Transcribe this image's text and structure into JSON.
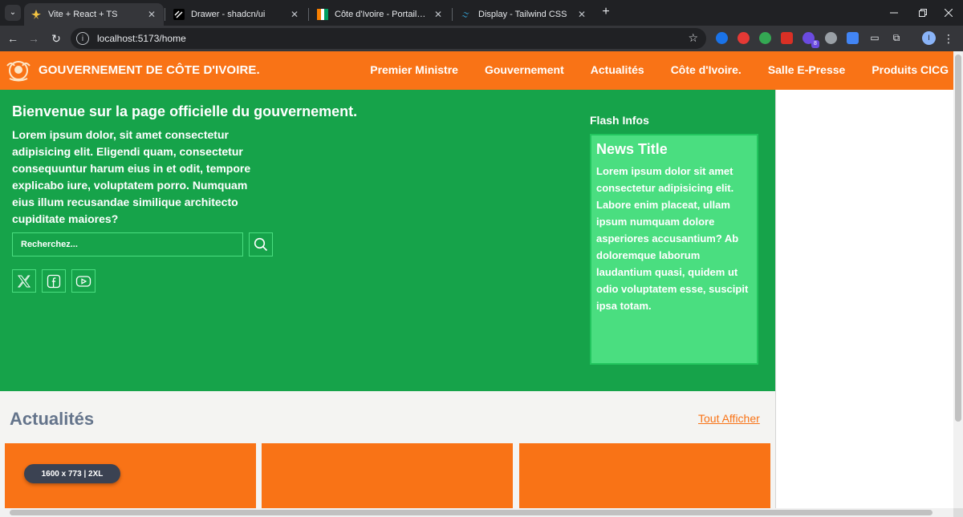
{
  "browser": {
    "tabs": [
      {
        "title": "Vite + React + TS",
        "favicon": "vite-icon",
        "active": true
      },
      {
        "title": "Drawer - shadcn/ui",
        "favicon": "shadcn-icon",
        "active": false
      },
      {
        "title": "Côte d'Ivoire - Portail officiel du",
        "favicon": "ivory-coast-flag-icon",
        "active": false
      },
      {
        "title": "Display - Tailwind CSS",
        "favicon": "tailwind-icon",
        "active": false
      }
    ],
    "tab_close": "✕",
    "new_tab": "+",
    "url": "localhost:5173/home",
    "extension_badge": "8",
    "profile_initial": "I"
  },
  "site": {
    "brand": "GOUVERNEMENT DE CÔTE D'IVOIRE.",
    "nav": [
      "Premier Ministre",
      "Gouvernement",
      "Actualités",
      "Côte d'Ivoire.",
      "Salle E-Presse",
      "Produits CICG"
    ]
  },
  "hero": {
    "title": "Bienvenue sur la page officielle du gouvernement.",
    "text": "Lorem ipsum dolor, sit amet consectetur adipisicing elit. Eligendi quam, consectetur consequuntur harum eius in et odit, tempore explicabo iure, voluptatem porro. Numquam eius illum recusandae similique architecto cupiditate maiores?",
    "search_placeholder": "Recherchez...",
    "social": [
      "x-icon",
      "facebook-icon",
      "youtube-icon"
    ]
  },
  "flash": {
    "label": "Flash Infos",
    "news_title": "News Title",
    "news_body": "Lorem ipsum dolor sit amet consectetur adipisicing elit. Labore enim placeat, ullam ipsum numquam dolore asperiores accusantium? Ab doloremque laborum laudantium quasi, quidem ut odio voluptatem esse, suscipit ipsa totam."
  },
  "actualites": {
    "title": "Actualités",
    "link": "Tout Afficher"
  },
  "dev_badge": "1600 x 773  |  2XL",
  "colors": {
    "orange": "#f97316",
    "green": "#16a34a",
    "light_green": "#4ade80",
    "slate": "#64748b"
  }
}
